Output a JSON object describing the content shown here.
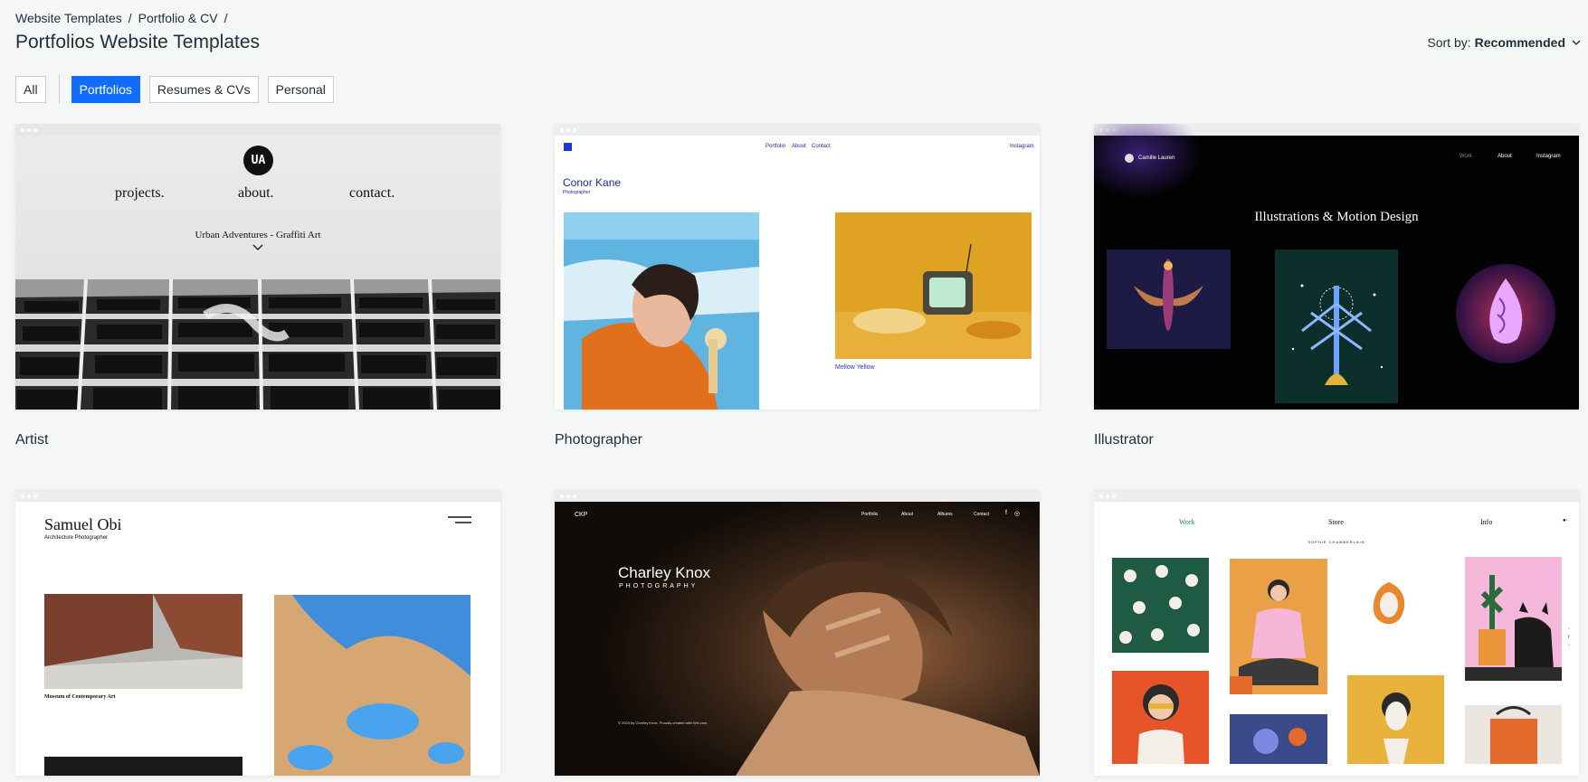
{
  "breadcrumb": {
    "items": [
      "Website Templates",
      "Portfolio & CV"
    ],
    "separator": "/"
  },
  "page": {
    "title": "Portfolios Website Templates"
  },
  "sort": {
    "label": "Sort by:",
    "value": "Recommended",
    "icon": "chevron-down-icon"
  },
  "filters": {
    "items": [
      "All",
      "Portfolios",
      "Resumes & CVs",
      "Personal"
    ],
    "active": "Portfolios"
  },
  "colors": {
    "accent": "#116dff",
    "background": "#f5f6f6",
    "text": "#20303c"
  },
  "cards": [
    {
      "title": "Artist",
      "preview": {
        "logo": "UA",
        "nav": [
          "projects.",
          "about.",
          "contact."
        ],
        "subtitle": "Urban Adventures - Graffiti Art"
      }
    },
    {
      "title": "Photographer",
      "preview": {
        "nav": [
          "Portfolio",
          "About",
          "Contact"
        ],
        "social": "Instagram",
        "name": "Conor Kane",
        "role": "Photographer",
        "caption": "Mellow Yellow"
      }
    },
    {
      "title": "Illustrator",
      "preview": {
        "brand": "Camille Lauren",
        "nav": [
          "Work",
          "About",
          "Instagram"
        ],
        "headline": "Illustrations & Motion Design"
      }
    },
    {
      "title": "",
      "preview": {
        "name": "Samuel Obi",
        "role": "Architecture Photographer",
        "caption": "Museum of Contemporary Art"
      }
    },
    {
      "title": "",
      "preview": {
        "brand": "CKP",
        "nav": [
          "Portfolio",
          "About",
          "Albums",
          "Contact"
        ],
        "name": "Charley Knox",
        "role": "PHOTOGRAPHY",
        "footer": "© 2023 by Charley Knox. Proudly created with Wix.com"
      }
    },
    {
      "title": "",
      "preview": {
        "nav": [
          "Work",
          "Store",
          "Info"
        ],
        "brand": "SOPHIE CHAMBERLAIN"
      }
    }
  ]
}
